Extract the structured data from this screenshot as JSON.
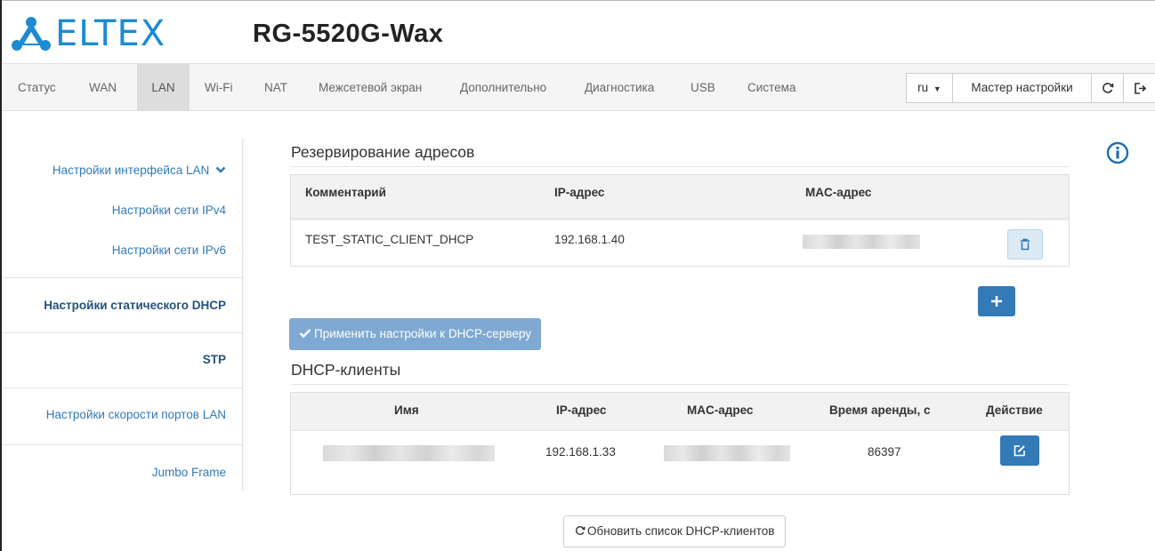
{
  "brand": {
    "logo_text": "ELTEX",
    "model": "RG-5520G-Wax",
    "logo_color": "#1d8bd1"
  },
  "nav": {
    "items": [
      "Статус",
      "WAN",
      "LAN",
      "Wi-Fi",
      "NAT",
      "Межсетевой экран",
      "Дополнительно",
      "Диагностика",
      "USB",
      "Система"
    ],
    "active": "LAN",
    "lang": "ru",
    "wizard": "Мастер настройки"
  },
  "sidebar": {
    "group": "Настройки интерфейса LAN",
    "sub_ipv4": "Настройки сети IPv4",
    "sub_ipv6": "Настройки сети IPv6",
    "static_dhcp": "Настройки статического DHCP",
    "stp": "STP",
    "port_speed": "Настройки скорости портов LAN",
    "jumbo": "Jumbo Frame"
  },
  "reservation": {
    "title": "Резервирование адресов",
    "headers": {
      "comment": "Комментарий",
      "ip": "IP-адрес",
      "mac": "MAC-адрес"
    },
    "rows": [
      {
        "comment": "TEST_STATIC_CLIENT_DHCP",
        "ip": "192.168.1.40",
        "mac": ""
      }
    ],
    "apply_label": "Применить настройки к DHCP-серверу"
  },
  "clients": {
    "title": "DHCP-клиенты",
    "headers": {
      "name": "Имя",
      "ip": "IP-адрес",
      "mac": "MAC-адрес",
      "lease": "Время аренды, с",
      "action": "Действие"
    },
    "rows": [
      {
        "name": "",
        "ip": "192.168.1.33",
        "mac": "",
        "lease": "86397"
      }
    ],
    "refresh_label": "Обновить список DHCP-клиентов"
  },
  "colors": {
    "primary": "#337ab7",
    "apply_disabled": "#7fa9d2",
    "link": "#337ab7"
  }
}
